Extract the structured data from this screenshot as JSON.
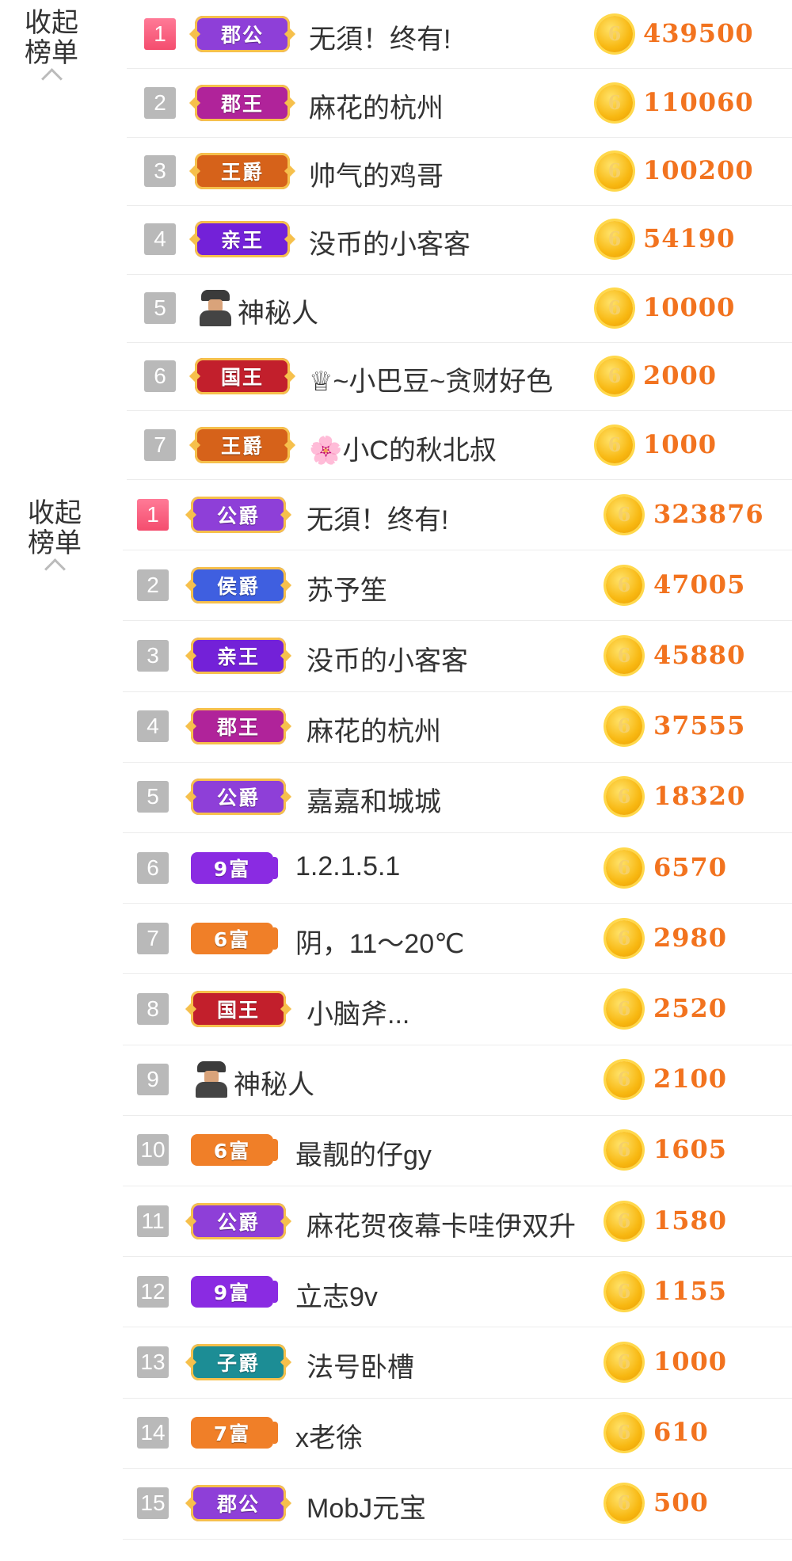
{
  "boards": [
    {
      "collapse_label": "收起\n榜单",
      "rows": [
        {
          "rank": "1",
          "badge": "郡公",
          "badge_style": "purple-gold",
          "name": "无須！终有!",
          "amount": "439500"
        },
        {
          "rank": "2",
          "badge": "郡王",
          "badge_style": "magenta-gold",
          "name": "麻花的杭州",
          "amount": "110060"
        },
        {
          "rank": "3",
          "badge": "王爵",
          "badge_style": "orange-gold",
          "name": "帅气的鸡哥",
          "amount": "100200"
        },
        {
          "rank": "4",
          "badge": "亲王",
          "badge_style": "violet-gold",
          "name": "没币的小客客",
          "amount": "54190"
        },
        {
          "rank": "5",
          "badge": "",
          "badge_style": "mystery",
          "name": "神秘人",
          "amount": "10000"
        },
        {
          "rank": "6",
          "badge": "国王",
          "badge_style": "red-gold",
          "name": "♕~小巴豆~贪财好色",
          "amount": "2000"
        },
        {
          "rank": "7",
          "badge": "王爵",
          "badge_style": "orange-gold",
          "name": "🌸小C的秋北叔",
          "amount": "1000"
        }
      ]
    },
    {
      "collapse_label": "收起\n榜单",
      "rows": [
        {
          "rank": "1",
          "badge": "公爵",
          "badge_style": "purple-gold",
          "name": "无須！终有!",
          "amount": "323876"
        },
        {
          "rank": "2",
          "badge": "侯爵",
          "badge_style": "blue-gold",
          "name": "苏予笙",
          "amount": "47005"
        },
        {
          "rank": "3",
          "badge": "亲王",
          "badge_style": "violet-gold",
          "name": "没币的小客客",
          "amount": "45880"
        },
        {
          "rank": "4",
          "badge": "郡王",
          "badge_style": "magenta-gold",
          "name": "麻花的杭州",
          "amount": "37555"
        },
        {
          "rank": "5",
          "badge": "公爵",
          "badge_style": "purple-gold",
          "name": "嘉嘉和城城",
          "amount": "18320"
        },
        {
          "rank": "6",
          "badge": "9富",
          "badge_style": "fortune-purple",
          "name": "1.2.1.5.1",
          "amount": "6570"
        },
        {
          "rank": "7",
          "badge": "6富",
          "badge_style": "fortune-orange",
          "name": "阴，11～20℃",
          "amount": "2980"
        },
        {
          "rank": "8",
          "badge": "国王",
          "badge_style": "red-gold",
          "name": "小脑斧...",
          "amount": "2520"
        },
        {
          "rank": "9",
          "badge": "",
          "badge_style": "mystery",
          "name": "神秘人",
          "amount": "2100"
        },
        {
          "rank": "10",
          "badge": "6富",
          "badge_style": "fortune-orange",
          "name": "最靓的仔gy",
          "amount": "1605"
        },
        {
          "rank": "11",
          "badge": "公爵",
          "badge_style": "purple-gold",
          "name": "麻花贺夜幕卡哇伊双升",
          "amount": "1580"
        },
        {
          "rank": "12",
          "badge": "9富",
          "badge_style": "fortune-purple",
          "name": "立志9v",
          "amount": "1155"
        },
        {
          "rank": "13",
          "badge": "子爵",
          "badge_style": "teal-gold",
          "name": "法号卧槽",
          "amount": "1000"
        },
        {
          "rank": "14",
          "badge": "7富",
          "badge_style": "fortune-orange",
          "name": "x老徐",
          "amount": "610"
        },
        {
          "rank": "15",
          "badge": "郡公",
          "badge_style": "purple-gold",
          "name": "MobJ元宝",
          "amount": "500"
        }
      ]
    }
  ],
  "coin_glyph": "6",
  "colors": {
    "amount": "#f2731f",
    "top_rank": "#f4587a",
    "rank": "#b9b9b9",
    "purple-gold": "#8e3fd8",
    "magenta-gold": "#b0239a",
    "orange-gold": "#d6621a",
    "violet-gold": "#7321d8",
    "red-gold": "#c21f2c",
    "blue-gold": "#3f5fe0",
    "teal-gold": "#1c8d95",
    "fortune-purple": "#8a2be2",
    "fortune-orange": "#f07f28"
  }
}
